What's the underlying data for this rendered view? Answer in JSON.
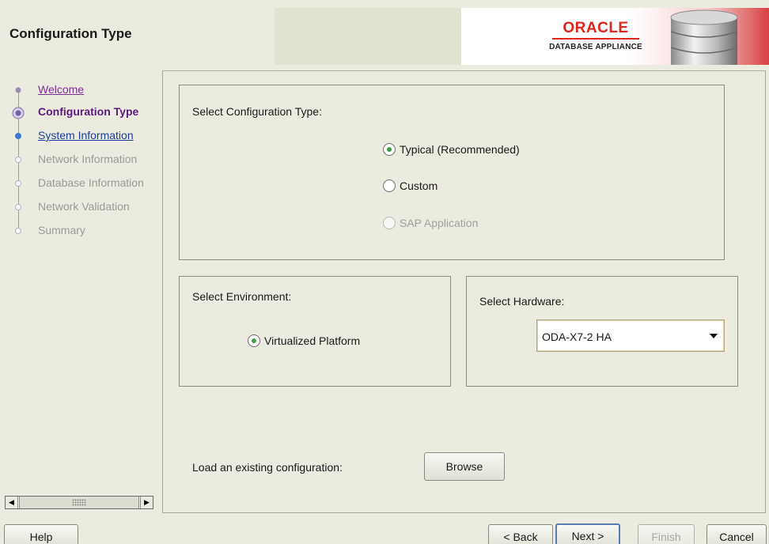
{
  "header": {
    "title": "Configuration Type",
    "logo_word": "ORACLE",
    "logo_sub": "DATABASE APPLIANCE"
  },
  "steps": [
    {
      "label": "Welcome",
      "state": "visited"
    },
    {
      "label": "Configuration Type",
      "state": "current"
    },
    {
      "label": "System Information",
      "state": "link"
    },
    {
      "label": "Network Information",
      "state": "disabled"
    },
    {
      "label": "Database Information",
      "state": "disabled"
    },
    {
      "label": "Network Validation",
      "state": "disabled"
    },
    {
      "label": "Summary",
      "state": "disabled"
    }
  ],
  "config_type": {
    "title": "Select Configuration Type:",
    "options": [
      {
        "label": "Typical (Recommended)",
        "checked": true,
        "enabled": true
      },
      {
        "label": "Custom",
        "checked": false,
        "enabled": true
      },
      {
        "label": "SAP Application",
        "checked": false,
        "enabled": false
      }
    ]
  },
  "environment": {
    "title": "Select Environment:",
    "option": "Virtualized Platform"
  },
  "hardware": {
    "title": "Select Hardware:",
    "selected": "ODA-X7-2 HA"
  },
  "load_config": {
    "label": "Load an existing configuration:",
    "browse_label": "Browse"
  },
  "footer": {
    "help_label": "Help",
    "back_label": "< Back",
    "next_label": "Next >",
    "finish_label": "Finish",
    "cancel_label": "Cancel"
  },
  "colors": {
    "accent_red": "#e0251b",
    "radio_checked": "#3aa043"
  }
}
